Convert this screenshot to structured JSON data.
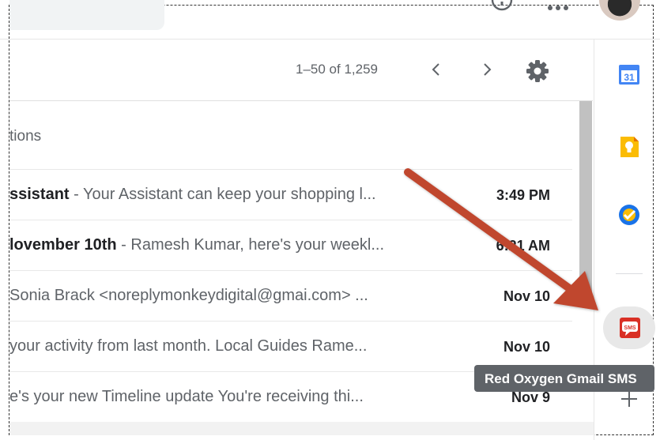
{
  "toolbar": {
    "page_range": "1–50 of 1,259"
  },
  "section": {
    "label": "tions"
  },
  "rows": [
    {
      "bold": "ssistant",
      "snippet": " - Your Assistant can keep your shopping l...",
      "time": "3:49 PM"
    },
    {
      "bold": "lovember 10th",
      "snippet": " - Ramesh Kumar, here's your weekl...",
      "time": "6:21 AM"
    },
    {
      "bold": "",
      "snippet": "Sonia Brack <noreplymonkeydigital@gmai.com> ...",
      "time": "Nov 10"
    },
    {
      "bold": "",
      "snippet": "your activity from last month. Local Guides Rame...",
      "time": "Nov 10"
    },
    {
      "bold": "",
      "snippet": "e's your new Timeline update You're receiving thi...",
      "time": "Nov 9"
    }
  ],
  "sidebar": {
    "calendar_number": "31",
    "sms_label": "SMS",
    "tooltip": "Red Oxygen Gmail SMS"
  },
  "colors": {
    "calendar_blue": "#4285f4",
    "keep_yellow": "#fbbc04",
    "tasks_blue": "#1a73e8",
    "sms_red": "#d93025",
    "arrow_red": "#c0462e"
  }
}
